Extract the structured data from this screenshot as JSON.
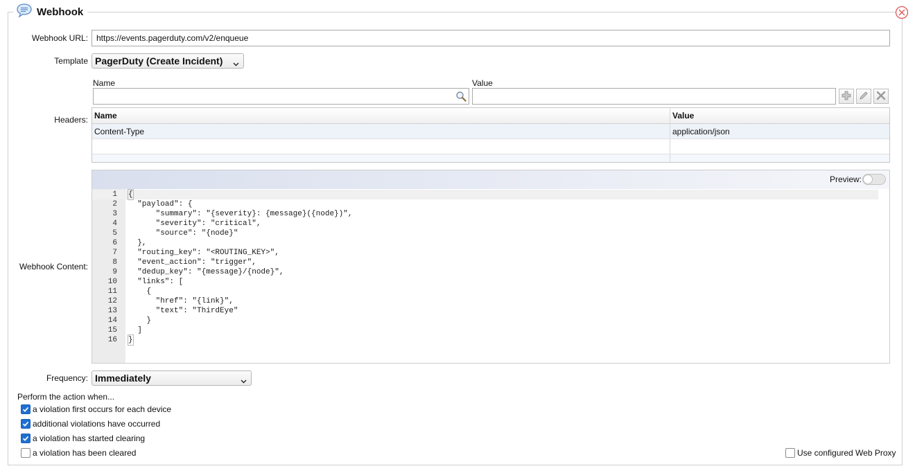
{
  "panel": {
    "title": "Webhook",
    "icon": "speech-bubble-icon"
  },
  "url": {
    "label": "Webhook URL:",
    "value": "https://events.pagerduty.com/v2/enqueue"
  },
  "template": {
    "label": "Template",
    "selected": "PagerDuty (Create Incident)"
  },
  "headers": {
    "label": "Headers:",
    "name_label": "Name",
    "value_label": "Value",
    "name_input": "",
    "value_input": "",
    "columns": [
      "Name",
      "Value"
    ],
    "rows": [
      {
        "name": "Content-Type",
        "value": "application/json"
      },
      {
        "name": "",
        "value": ""
      }
    ]
  },
  "content": {
    "label": "Webhook Content:",
    "preview_label": "Preview:",
    "preview_on": false,
    "lines": [
      "{",
      "  \"payload\": {",
      "      \"summary\": \"{severity}: {message}({node})\",",
      "      \"severity\": \"critical\",",
      "      \"source\": \"{node}\"",
      "  },",
      "  \"routing_key\": \"<ROUTING_KEY>\",",
      "  \"event_action\": \"trigger\",",
      "  \"dedup_key\": \"{message}/{node}\",",
      "  \"links\": [",
      "    {",
      "      \"href\": \"{link}\",",
      "      \"text\": \"ThirdEye\"",
      "    }",
      "  ]",
      "}"
    ],
    "line_numbers": [
      "1",
      "2",
      "3",
      "4",
      "5",
      "6",
      "7",
      "8",
      "9",
      "10",
      "11",
      "12",
      "13",
      "14",
      "15",
      "16"
    ]
  },
  "frequency": {
    "label": "Frequency:",
    "selected": "Immediately"
  },
  "perform": {
    "heading": "Perform the action when...",
    "options": [
      {
        "label": "a violation first occurs for each device",
        "checked": true
      },
      {
        "label": "additional violations have occurred",
        "checked": true
      },
      {
        "label": "a violation has started clearing",
        "checked": true
      },
      {
        "label": "a violation has been cleared",
        "checked": false
      }
    ]
  },
  "proxy": {
    "label": "Use configured Web Proxy",
    "checked": false
  },
  "colors": {
    "accent": "#1f6fd1",
    "close": "#e05a5a"
  }
}
